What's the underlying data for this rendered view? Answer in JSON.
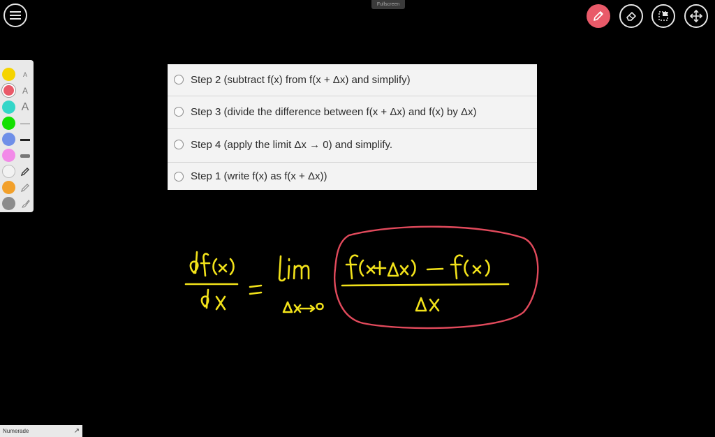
{
  "window": {
    "fullscreen_label": "Fullscreen"
  },
  "toolbar": {
    "tools": [
      {
        "name": "pencil",
        "active": true
      },
      {
        "name": "eraser",
        "active": false
      },
      {
        "name": "select",
        "active": false
      },
      {
        "name": "move",
        "active": false
      }
    ],
    "active_color": "#e95a69"
  },
  "palette": {
    "colors": [
      "#f5d400",
      "#e95a69",
      "#33d6c8",
      "#13e000",
      "#6f8fe8",
      "#f28ae8",
      "#f2f2f2",
      "#f2a02a",
      "#8c8c8c"
    ],
    "text_sizes": [
      "A",
      "A",
      "A"
    ]
  },
  "question": {
    "options": [
      {
        "label": "Step 2 (subtract f(x) from f(x + Δx) and simplify)"
      },
      {
        "label": "Step 3 (divide the difference between f(x + Δx) and f(x) by Δx)"
      },
      {
        "label": "Step 4 (apply the limit Δx → 0) and simplify."
      },
      {
        "label": "Step 1 (write f(x) as f(x + Δx))"
      }
    ]
  },
  "handwriting": {
    "ink_color": "#f2e21a",
    "circle_color": "#e24a5c"
  },
  "footer": {
    "brand": "Numerade",
    "expand_icon": "↗"
  }
}
